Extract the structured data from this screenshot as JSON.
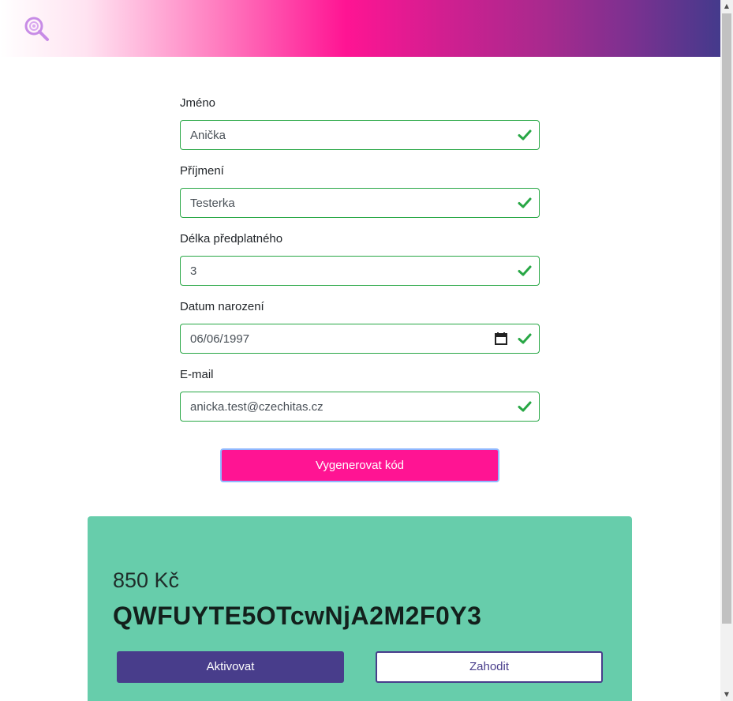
{
  "form": {
    "fields": [
      {
        "label": "Jméno",
        "value": "Anička"
      },
      {
        "label": "Příjmení",
        "value": "Testerka"
      },
      {
        "label": "Délka předplatného",
        "value": "3"
      },
      {
        "label": "Datum narození",
        "value": "06/06/1997"
      },
      {
        "label": "E-mail",
        "value": "anicka.test@czechitas.cz"
      }
    ],
    "submit_label": "Vygenerovat kód"
  },
  "result": {
    "price": "850 Kč",
    "code": "QWFUYTE5OTcwNjA2M2F0Y3",
    "activate_label": "Aktivovat",
    "discard_label": "Zahodit"
  },
  "colors": {
    "accent_pink": "#ff1493",
    "accent_purple": "#483d8b",
    "valid_green": "#28a745",
    "result_bg": "#67cdab"
  },
  "icons": {
    "logo": "magnifier-logo-icon",
    "check": "check-icon",
    "calendar": "calendar-icon"
  }
}
